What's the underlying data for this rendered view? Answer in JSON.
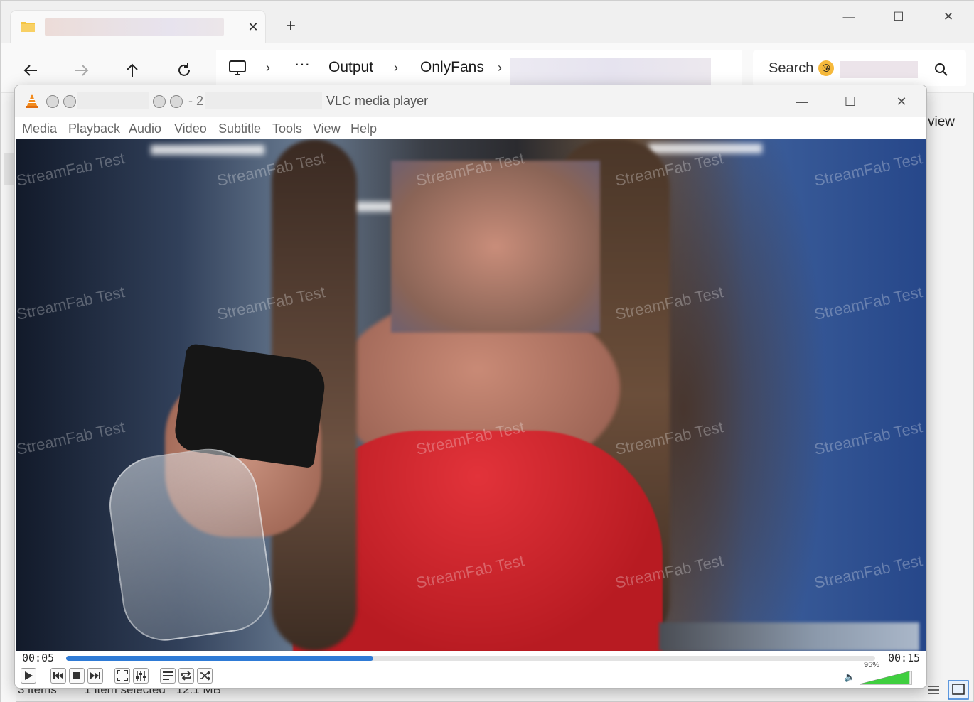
{
  "explorer": {
    "search_label": "Search",
    "breadcrumb": [
      "Output",
      "OnlyFans"
    ],
    "overflow_label": "···",
    "view_label": "view",
    "status": {
      "items": "3 items",
      "selected": "1 item selected",
      "size": "12.1 MB"
    }
  },
  "vlc": {
    "title_separator": "- 2",
    "title_suffix": "VLC media player",
    "menu": [
      "Media",
      "Playback",
      "Audio",
      "Video",
      "Subtitle",
      "Tools",
      "View",
      "Help"
    ],
    "elapsed": "00:05",
    "duration": "00:15",
    "progress": 0.38,
    "volume_label": "95%",
    "volume": 0.95
  },
  "watermark_text": "StreamFab Test",
  "colors": {
    "accent": "#2f7bd6",
    "volume": "#3fcf3f"
  }
}
